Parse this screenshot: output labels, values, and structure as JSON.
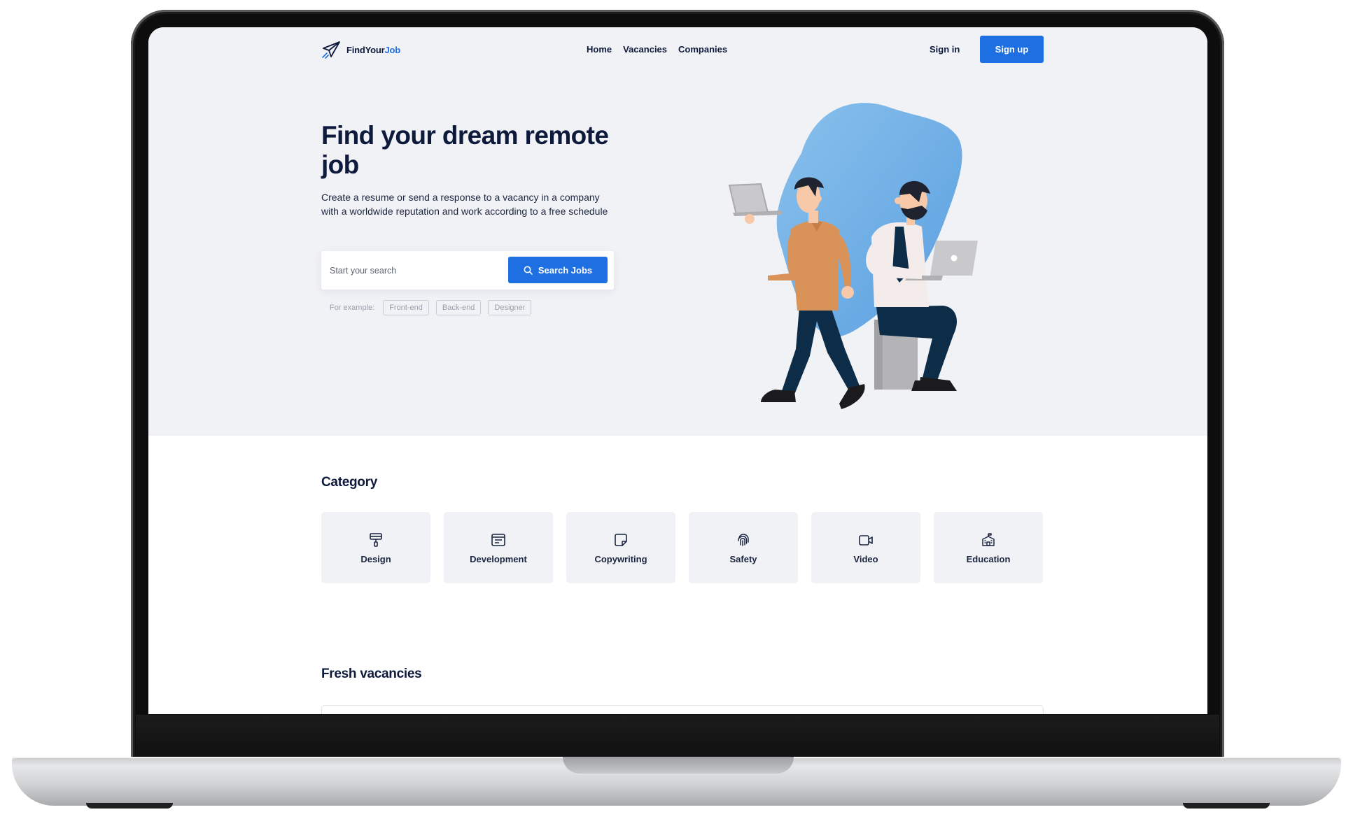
{
  "brand": {
    "name_part1": "FindYour",
    "name_part2": "Job",
    "accent_color": "#1e6fe2",
    "logo_icon": "paper-plane-icon"
  },
  "nav": {
    "items": [
      "Home",
      "Vacancies",
      "Companies"
    ]
  },
  "auth": {
    "signin": "Sign in",
    "signup": "Sign up"
  },
  "hero": {
    "title": "Find your dream remote job",
    "subtitle": "Create a resume or send a response to a vacancy in a company with a worldwide reputation and work according to a free schedule",
    "search_placeholder": "Start your search",
    "search_button": "Search Jobs",
    "search_icon": "search-icon",
    "examples_label": "For example:",
    "examples": [
      "Front-end",
      "Back-end",
      "Designer"
    ]
  },
  "category": {
    "title": "Category",
    "items": [
      {
        "label": "Design",
        "icon": "paint-roller-icon"
      },
      {
        "label": "Development",
        "icon": "code-window-icon"
      },
      {
        "label": "Copywriting",
        "icon": "sticky-note-icon"
      },
      {
        "label": "Safety",
        "icon": "fingerprint-icon"
      },
      {
        "label": "Video",
        "icon": "video-camera-icon"
      },
      {
        "label": "Education",
        "icon": "school-icon"
      }
    ]
  },
  "fresh": {
    "title": "Fresh vacancies"
  }
}
